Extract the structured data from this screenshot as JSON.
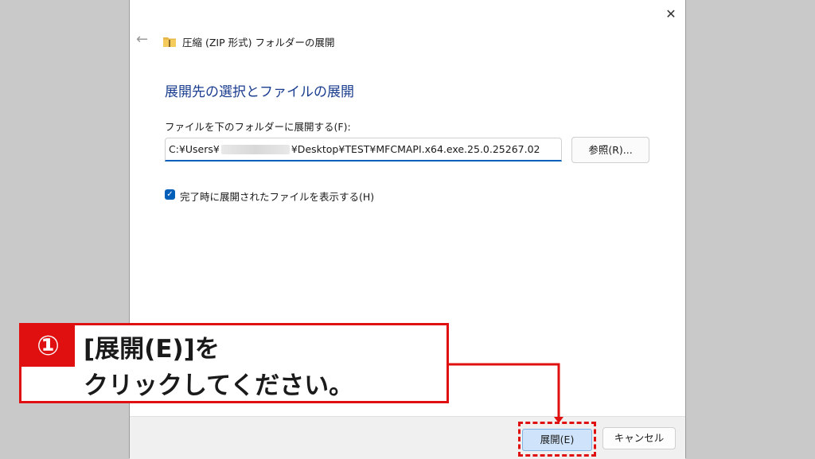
{
  "dialog": {
    "title": "圧縮 (ZIP 形式) フォルダーの展開",
    "close_glyph": "✕",
    "back_glyph": "←",
    "heading": "展開先の選択とファイルの展開",
    "field_label": "ファイルを下のフォルダーに展開する(F):",
    "path_prefix": "C:¥Users¥",
    "path_suffix": "¥Desktop¥TEST¥MFCMAPI.x64.exe.25.0.25267.02",
    "browse_label": "参照(R)...",
    "checkbox_checked": true,
    "checkbox_glyph": "✓",
    "checkbox_label": "完了時に展開されたファイルを表示する(H)",
    "extract_label": "展開(E)",
    "cancel_label": "キャンセル"
  },
  "callout": {
    "number": "①",
    "line1": "[展開(E)]を",
    "line2": "クリックしてください。"
  },
  "colors": {
    "accent": "#005fb8",
    "heading": "#1a3d8f",
    "highlight": "#e01010",
    "backdrop": "#c9c9c9"
  },
  "icons": {
    "back": "arrow-left-icon",
    "folder": "zip-folder-icon",
    "close": "close-icon",
    "checkbox": "checkmark-icon"
  }
}
